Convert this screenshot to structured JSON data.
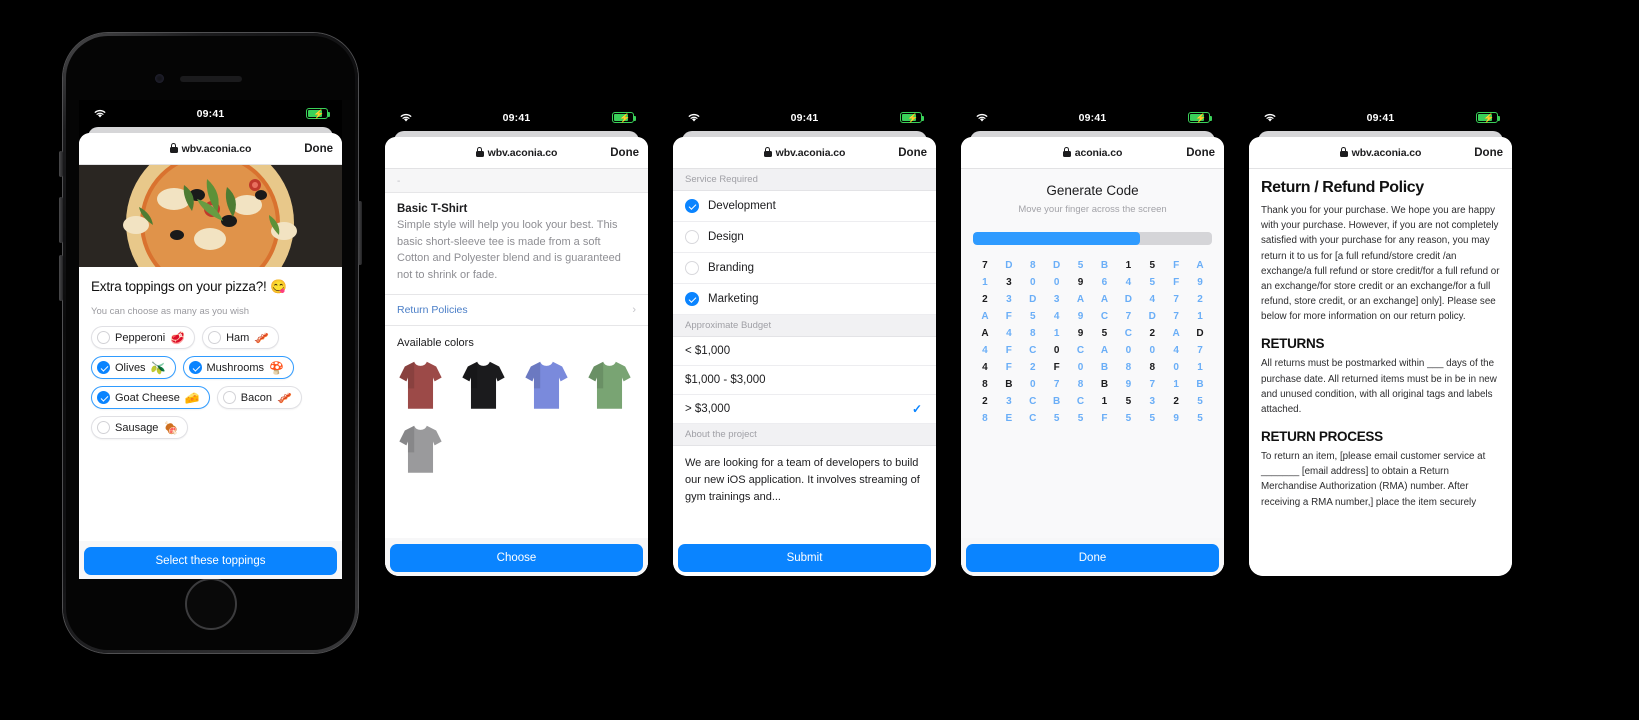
{
  "status_bar": {
    "time": "09:41",
    "wifi_icon": "wifi-icon",
    "battery_icon": "battery-charging-icon"
  },
  "screen1": {
    "url": "wbv.aconia.co",
    "done_label": "Done",
    "title": "Extra toppings on your pizza?! 😋",
    "subtitle": "You can choose as many as you wish",
    "toppings": [
      {
        "label": "Pepperoni",
        "emoji": "🥩",
        "selected": false
      },
      {
        "label": "Ham",
        "emoji": "🥓",
        "selected": false
      },
      {
        "label": "Olives",
        "emoji": "🫒",
        "selected": true
      },
      {
        "label": "Mushrooms",
        "emoji": "🍄",
        "selected": true
      },
      {
        "label": "Goat Cheese",
        "emoji": "🧀",
        "selected": true
      },
      {
        "label": "Bacon",
        "emoji": "🥓",
        "selected": false
      },
      {
        "label": "Sausage",
        "emoji": "🍖",
        "selected": false
      }
    ],
    "cta_label": "Select these toppings"
  },
  "screen2": {
    "url": "wbv.aconia.co",
    "done_label": "Done",
    "product_title": "Basic T-Shirt",
    "product_desc": "Simple style will help you look your best. This basic short-sleeve tee is made from a soft Cotton and Polyester blend and is guaranteed not to shrink or fade.",
    "return_link": "Return Policies",
    "colors_title": "Available colors",
    "colors": [
      {
        "name": "brick-red",
        "hex": "#9c4a48"
      },
      {
        "name": "black",
        "hex": "#1b1b1d"
      },
      {
        "name": "periwinkle-blue",
        "hex": "#7a8adc"
      },
      {
        "name": "sage-green",
        "hex": "#79a473"
      },
      {
        "name": "heather-grey",
        "hex": "#9a9a9c"
      }
    ],
    "cta_label": "Choose"
  },
  "screen3": {
    "url": "wbv.aconia.co",
    "done_label": "Done",
    "section_service": "Service Required",
    "services": [
      {
        "label": "Development",
        "selected": true
      },
      {
        "label": "Design",
        "selected": false
      },
      {
        "label": "Branding",
        "selected": false
      },
      {
        "label": "Marketing",
        "selected": true
      }
    ],
    "section_budget": "Approximate Budget",
    "budgets": [
      {
        "label": "< $1,000",
        "selected": false
      },
      {
        "label": "$1,000 - $3,000",
        "selected": false
      },
      {
        "label": "> $3,000",
        "selected": true
      }
    ],
    "section_about": "About the project",
    "about_text": "We are looking for a team of developers to build our new iOS application. It involves streaming of gym trainings and...",
    "cta_label": "Submit"
  },
  "screen4": {
    "url": "aconia.co",
    "done_label": "Done",
    "title": "Generate Code",
    "subtitle": "Move your finger across the screen",
    "progress_percent": 70,
    "code_grid": [
      [
        "7",
        "D",
        "8",
        "D",
        "5",
        "B",
        "1",
        "5",
        "F",
        "A"
      ],
      [
        "1",
        "3",
        "0",
        "0",
        "9",
        "6",
        "4",
        "5",
        "F",
        "9"
      ],
      [
        "2",
        "3",
        "D",
        "3",
        "A",
        "A",
        "D",
        "4",
        "7",
        "2"
      ],
      [
        "A",
        "F",
        "5",
        "4",
        "9",
        "C",
        "7",
        "D",
        "7",
        "1"
      ],
      [
        "A",
        "4",
        "8",
        "1",
        "9",
        "5",
        "C",
        "2",
        "A",
        "D"
      ],
      [
        "4",
        "F",
        "C",
        "0",
        "C",
        "A",
        "0",
        "0",
        "4",
        "7"
      ],
      [
        "4",
        "F",
        "2",
        "F",
        "0",
        "B",
        "8",
        "8",
        "0",
        "1"
      ],
      [
        "8",
        "B",
        "0",
        "7",
        "8",
        "B",
        "9",
        "7",
        "1",
        "B"
      ],
      [
        "2",
        "3",
        "C",
        "B",
        "C",
        "1",
        "5",
        "3",
        "2",
        "5"
      ],
      [
        "8",
        "E",
        "C",
        "5",
        "5",
        "F",
        "5",
        "5",
        "9",
        "5"
      ]
    ],
    "code_grid_highlight": [
      [
        0,
        1,
        1,
        1,
        1,
        1,
        0,
        0,
        1,
        1
      ],
      [
        1,
        0,
        1,
        1,
        0,
        1,
        1,
        1,
        1,
        1
      ],
      [
        0,
        1,
        1,
        1,
        1,
        1,
        1,
        1,
        1,
        1
      ],
      [
        1,
        1,
        1,
        1,
        1,
        1,
        1,
        1,
        1,
        1
      ],
      [
        0,
        1,
        1,
        1,
        0,
        0,
        1,
        0,
        1,
        0
      ],
      [
        1,
        1,
        1,
        0,
        1,
        1,
        1,
        1,
        1,
        1
      ],
      [
        0,
        1,
        1,
        0,
        1,
        1,
        1,
        0,
        1,
        1
      ],
      [
        0,
        0,
        1,
        1,
        1,
        0,
        1,
        1,
        1,
        1
      ],
      [
        0,
        1,
        1,
        1,
        1,
        0,
        0,
        1,
        0,
        1
      ],
      [
        1,
        1,
        1,
        1,
        1,
        1,
        1,
        1,
        1,
        1
      ]
    ],
    "cta_label": "Done"
  },
  "screen5": {
    "url": "wbv.aconia.co",
    "done_label": "Done",
    "title": "Return / Refund Policy",
    "intro": "Thank you for your purchase. We hope you are happy with your purchase. However, if you are not completely satisfied with your purchase for any reason, you may return it to us for [a full refund/store credit /an exchange/a full refund or store credit/for a full refund or an exchange/for store credit or an exchange/for a full refund, store credit, or an exchange] only]. Please see below for more information on our return policy.",
    "returns_heading": "RETURNS",
    "returns_body": "All returns must be postmarked within ___ days of the purchase date. All returned items must be in be in new and unused condition, with all original tags and labels attached.",
    "process_heading": "RETURN PROCESS",
    "process_body": "To return an item, [please email customer service at _______ [email address] to obtain a Return Merchandise Authorization (RMA) number. After receiving a RMA number,] place the item securely"
  }
}
